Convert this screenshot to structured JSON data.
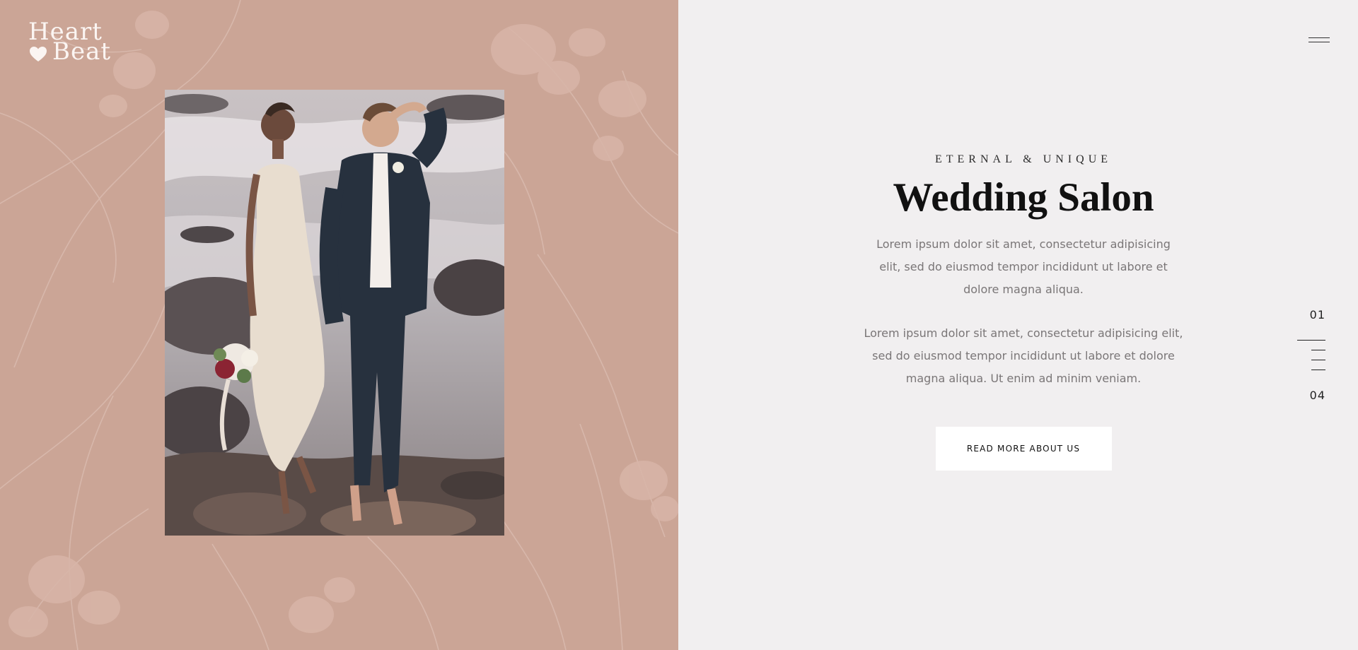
{
  "brand": {
    "logo_line1": "Heart",
    "logo_line2": "Beat"
  },
  "hero": {
    "eyebrow": "ETERNAL & UNIQUE",
    "title": "Wedding Salon",
    "paragraph1": "Lorem ipsum dolor sit amet, consectetur adipisicing elit, sed do eiusmod tempor incididunt ut labore et dolore magna aliqua.",
    "paragraph2": "Lorem ipsum dolor sit amet, consectetur adipisicing elit, sed do eiusmod tempor incididunt ut labore et dolore magna aliqua. Ut enim ad minim veniam.",
    "cta_label": "READ MORE ABOUT US"
  },
  "pager": {
    "current": "01",
    "total": "04"
  },
  "icons": {
    "menu": "hamburger-menu-icon",
    "logo_heart": "heart-icon"
  },
  "colors": {
    "left_panel": "#cba596",
    "right_panel": "#f1eff0",
    "button_bg": "#ffffff",
    "title_text": "#111111",
    "body_text": "#7a7677"
  }
}
